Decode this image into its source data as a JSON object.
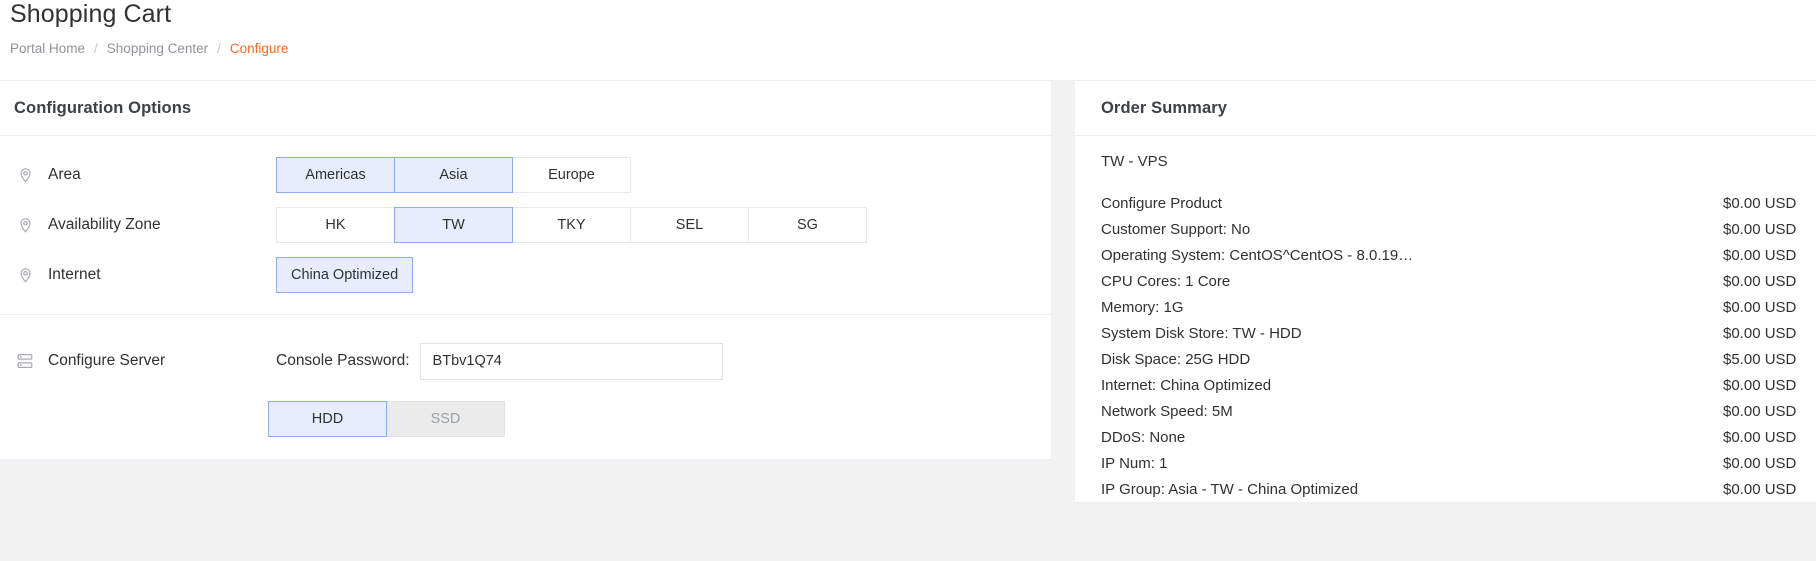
{
  "header": {
    "title": "Shopping Cart",
    "breadcrumb": [
      {
        "label": "Portal Home",
        "active": false
      },
      {
        "label": "Shopping Center",
        "active": false
      },
      {
        "label": "Configure",
        "active": true
      }
    ],
    "separator": "/"
  },
  "config_panel": {
    "title": "Configuration Options",
    "rows": [
      {
        "label": "Area",
        "icon": "location-pin-icon",
        "options": [
          {
            "label": "Americas",
            "selected": false,
            "disabled": false
          },
          {
            "label": "Asia",
            "selected": true,
            "disabled": false
          },
          {
            "label": "Europe",
            "selected": false,
            "disabled": false
          }
        ]
      },
      {
        "label": "Availability Zone",
        "icon": "location-pin-icon",
        "options": [
          {
            "label": "HK",
            "selected": false,
            "disabled": false
          },
          {
            "label": "TW",
            "selected": true,
            "disabled": false
          },
          {
            "label": "TKY",
            "selected": false,
            "disabled": false
          },
          {
            "label": "SEL",
            "selected": false,
            "disabled": false
          },
          {
            "label": "SG",
            "selected": false,
            "disabled": false
          }
        ]
      },
      {
        "label": "Internet",
        "icon": "location-pin-icon",
        "options": [
          {
            "label": "China Optimized",
            "selected": true,
            "disabled": false
          }
        ]
      }
    ],
    "server_section": {
      "label": "Configure Server",
      "icon": "server-icon",
      "password_label": "Console Password:",
      "password_value": "BTbv1Q74",
      "password_placeholder": "",
      "storage_options": [
        {
          "label": "HDD",
          "selected": true,
          "disabled": false
        },
        {
          "label": "SSD",
          "selected": false,
          "disabled": true
        }
      ]
    }
  },
  "order_summary": {
    "title": "Order Summary",
    "product": "TW - VPS",
    "lines": [
      {
        "desc": "Configure Product",
        "price": "$0.00 USD"
      },
      {
        "desc": "Customer Support: No",
        "price": "$0.00 USD"
      },
      {
        "desc": "Operating System: CentOS^CentOS - 8.0.19…",
        "price": "$0.00 USD"
      },
      {
        "desc": "CPU Cores: 1 Core",
        "price": "$0.00 USD"
      },
      {
        "desc": "Memory: 1G",
        "price": "$0.00 USD"
      },
      {
        "desc": "System Disk Store: TW - HDD",
        "price": "$0.00 USD"
      },
      {
        "desc": "Disk Space: 25G HDD",
        "price": "$5.00 USD"
      },
      {
        "desc": "Internet: China Optimized",
        "price": "$0.00 USD"
      },
      {
        "desc": "Network Speed: 5M",
        "price": "$0.00 USD"
      },
      {
        "desc": "DDoS: None",
        "price": "$0.00 USD"
      },
      {
        "desc": "IP Num: 1",
        "price": "$0.00 USD"
      },
      {
        "desc": "IP Group: Asia - TW - China Optimized",
        "price": "$0.00 USD"
      }
    ]
  },
  "colors": {
    "accent_orange": "#f56a21",
    "selected_fill": "#e8edfd",
    "selected_border": "#94a9e8",
    "text_primary": "#303133",
    "text_muted": "#909399"
  }
}
